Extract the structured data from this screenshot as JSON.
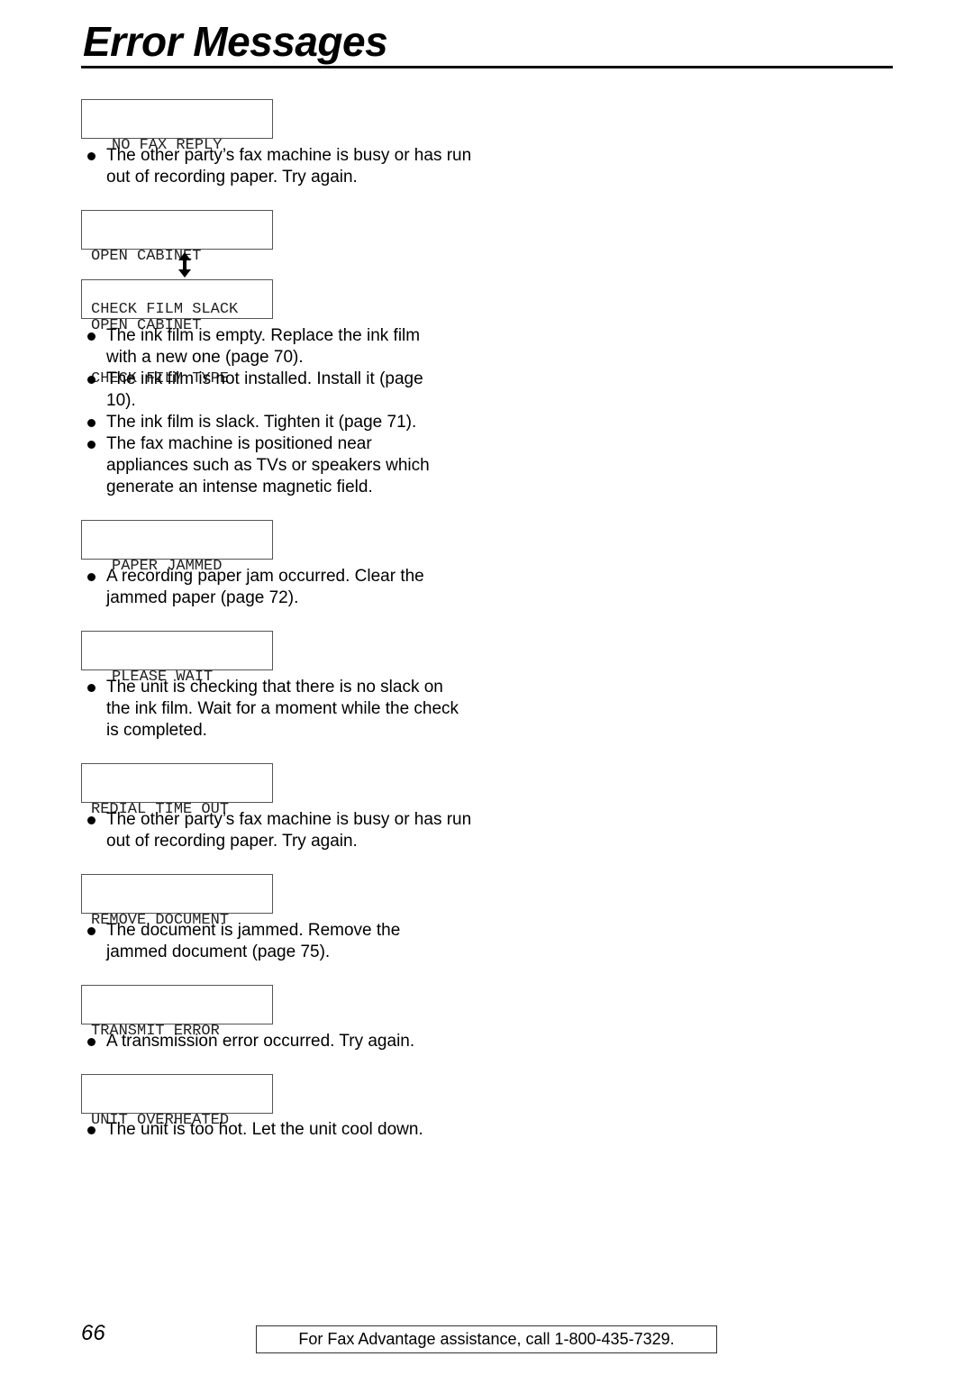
{
  "page": {
    "title": "Error Messages",
    "page_number": "66",
    "footer": "For Fax Advantage assistance, call 1-800-435-7329."
  },
  "sections": [
    {
      "display": [
        "NO FAX REPLY"
      ],
      "bullets": [
        "The other party’s fax machine is busy or has run out of recording paper. Try again."
      ]
    },
    {
      "display": [
        "OPEN CABINET",
        "CHECK FILM SLACK"
      ],
      "alternate_icon": "up-down-arrow",
      "display_alt": [
        "OPEN CABINET",
        "CHECK FILM TYPE"
      ],
      "bullets": [
        "The ink film is empty. Replace the ink film with a new one (page 70).",
        "The ink film is not installed. Install it (page 10).",
        "The ink film is slack. Tighten it (page 71).",
        "The fax machine is positioned near appliances such as TVs or speakers which generate an intense magnetic field."
      ]
    },
    {
      "display": [
        "PAPER JAMMED"
      ],
      "bullets": [
        "A recording paper jam occurred. Clear the jammed paper (page 72)."
      ]
    },
    {
      "display": [
        "PLEASE WAIT"
      ],
      "bullets": [
        "The unit is checking that there is no slack on the ink film. Wait for a moment while the check is completed."
      ]
    },
    {
      "display": [
        "REDIAL TIME OUT"
      ],
      "bullets": [
        "The other party’s fax machine is busy or has run out of recording paper. Try again."
      ]
    },
    {
      "display": [
        "REMOVE DOCUMENT"
      ],
      "bullets": [
        "The document is jammed. Remove the jammed document (page 75)."
      ]
    },
    {
      "display": [
        "TRANSMIT ERROR"
      ],
      "bullets": [
        "A transmission error occurred. Try again."
      ]
    },
    {
      "display": [
        "UNIT OVERHEATED"
      ],
      "bullets": [
        "The unit is too hot. Let the unit cool down."
      ]
    }
  ]
}
